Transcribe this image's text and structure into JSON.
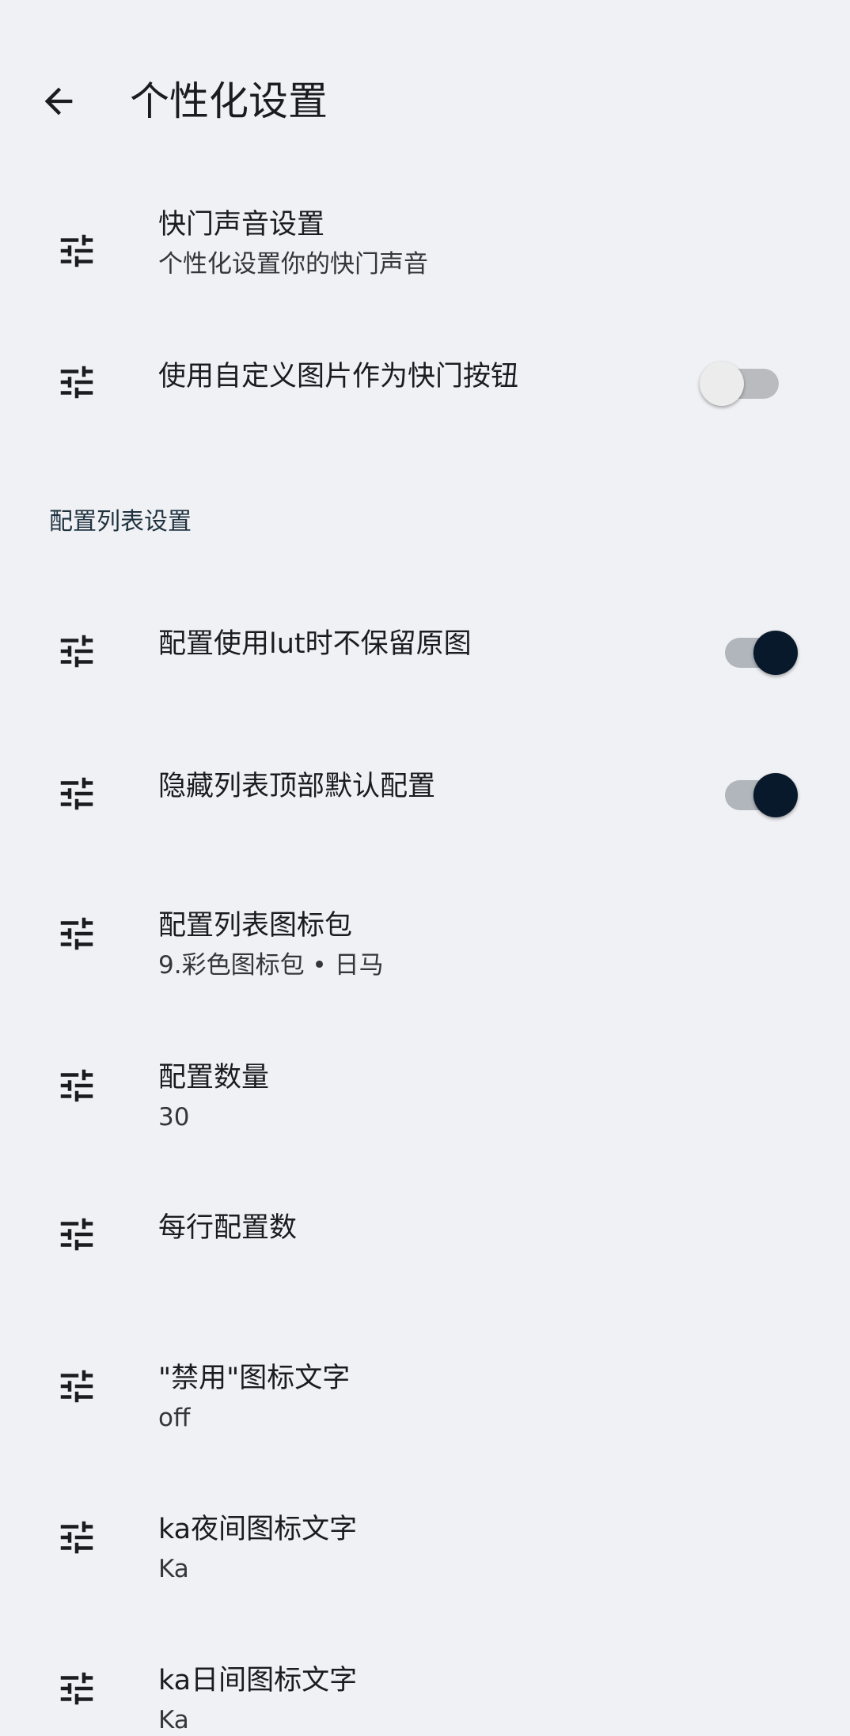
{
  "header": {
    "title": "个性化设置"
  },
  "rows_top": [
    {
      "label": "快门声音设置",
      "sub": "个性化设置你的快门声音"
    },
    {
      "label": "使用自定义图片作为快门按钮",
      "switch": "off"
    }
  ],
  "section": {
    "title": "配置列表设置"
  },
  "rows": [
    {
      "label": "配置使用lut时不保留原图",
      "switch": "on"
    },
    {
      "label": "隐藏列表顶部默认配置",
      "switch": "on"
    },
    {
      "label": "配置列表图标包",
      "sub": "9.彩色图标包 • 日马"
    },
    {
      "label": "配置数量",
      "sub": "30"
    },
    {
      "label": "每行配置数"
    },
    {
      "label": "\"禁用\"图标文字",
      "sub": "off"
    },
    {
      "label": "ka夜间图标文字",
      "sub": "Ka"
    },
    {
      "label": "ka日间图标文字",
      "sub": "Ka"
    }
  ],
  "icons": {
    "back": "arrow-back-icon",
    "row": "tune-sliders-icon"
  },
  "colors": {
    "background": "#f0f1f4",
    "switch_on_thumb": "#07192a",
    "section_header": "#1f3240"
  }
}
